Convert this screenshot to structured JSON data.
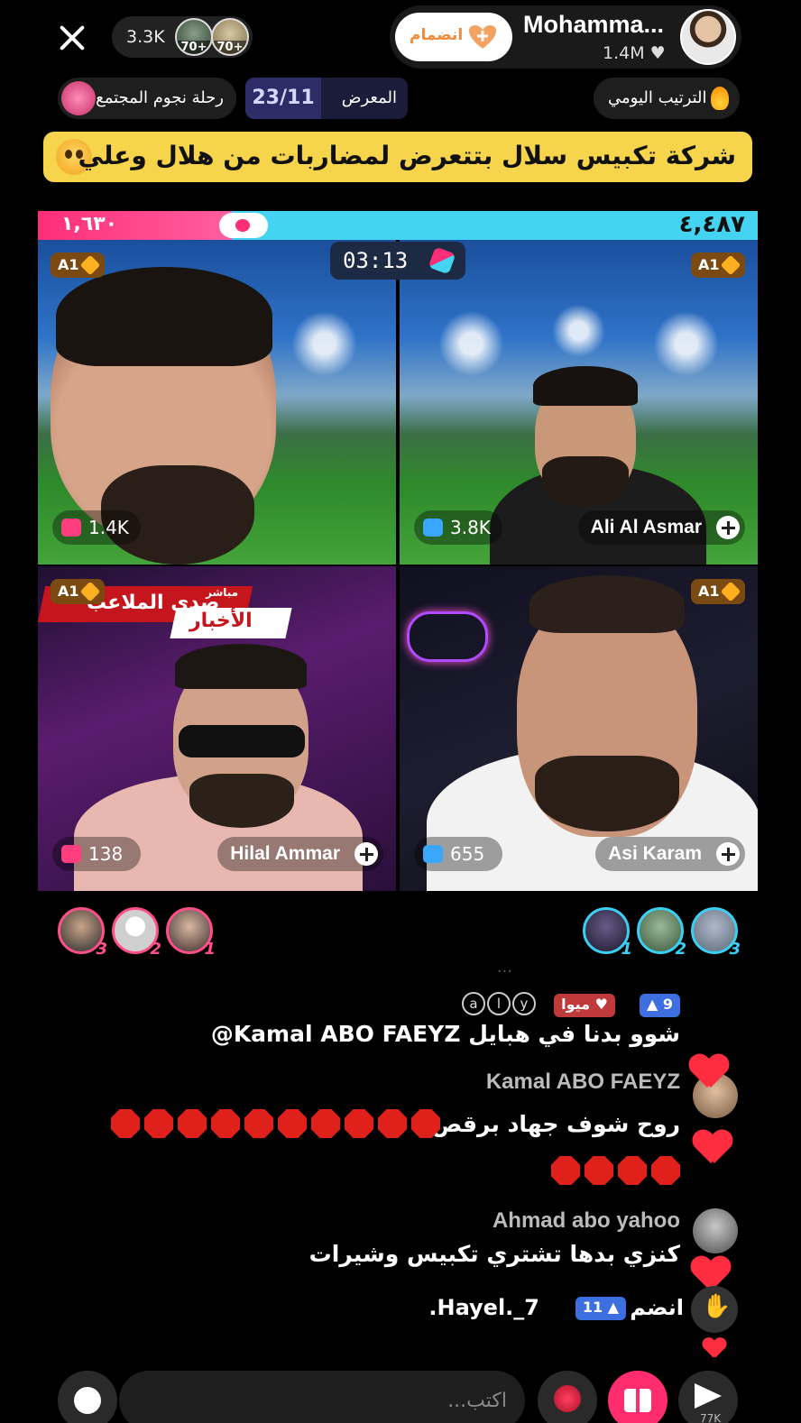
{
  "header": {
    "viewer_count": "3.3K",
    "top_viewers": [
      {
        "level": "70+"
      },
      {
        "level": "70+"
      }
    ],
    "join_label": "انضمام",
    "host_name": "Mohamma...",
    "host_likes": "1.4M",
    "community_chip": "رحلة نجوم المجتمع",
    "gallery_count": "23/11",
    "gallery_label": "المعرض",
    "daily_rank": "الترتيب اليومي"
  },
  "banner": {
    "text": "شركة تكبيس سلال بتتعرض لمضاربات من هلال وعلي"
  },
  "battle": {
    "left_score": "١,٦٣٠",
    "right_score": "٤,٤٨٧",
    "timer": "03:13",
    "progress_left_fraction": 0.27,
    "tiles": [
      {
        "badge": "A1",
        "points": "1.4K",
        "name": ""
      },
      {
        "badge": "A1",
        "points": "3.8K",
        "name": "Ali Al Asmar"
      },
      {
        "badge": "A1",
        "points": "138",
        "name": "Hilal Ammar",
        "news_live": "مباشر",
        "news_title": "صدى الملاعب",
        "news_sub": "الأخبار"
      },
      {
        "badge": "A1",
        "points": "655",
        "name": "Asi Karam"
      }
    ]
  },
  "supporters": {
    "left": [
      "3",
      "2",
      "1"
    ],
    "right": [
      "1",
      "2",
      "3"
    ]
  },
  "chat": {
    "faded_text": "...",
    "messages": [
      {
        "tag_level": "9",
        "tag_name": "ميوا",
        "rings": [
          "a",
          "l",
          "y"
        ],
        "text": "@Kamal  ABO FAEYZ  شوو بدنا في هبايل"
      },
      {
        "user": "Kamal  ABO FAEYZ",
        "text": "روح شوف جهاد برقص"
      },
      {
        "user": "Ahmad abo yahoo",
        "text": "كنزي بدها تشتري تكبيس وشيرات"
      }
    ],
    "join_word": "انضم",
    "join_level": "11",
    "join_user": ".Hayel._7"
  },
  "footer": {
    "input_placeholder": "اكتب...",
    "share_count": "77K"
  },
  "colors": {
    "accent_pink": "#ff2e78",
    "accent_cyan": "#44d4f2",
    "banner_yellow": "#f6d44b"
  }
}
